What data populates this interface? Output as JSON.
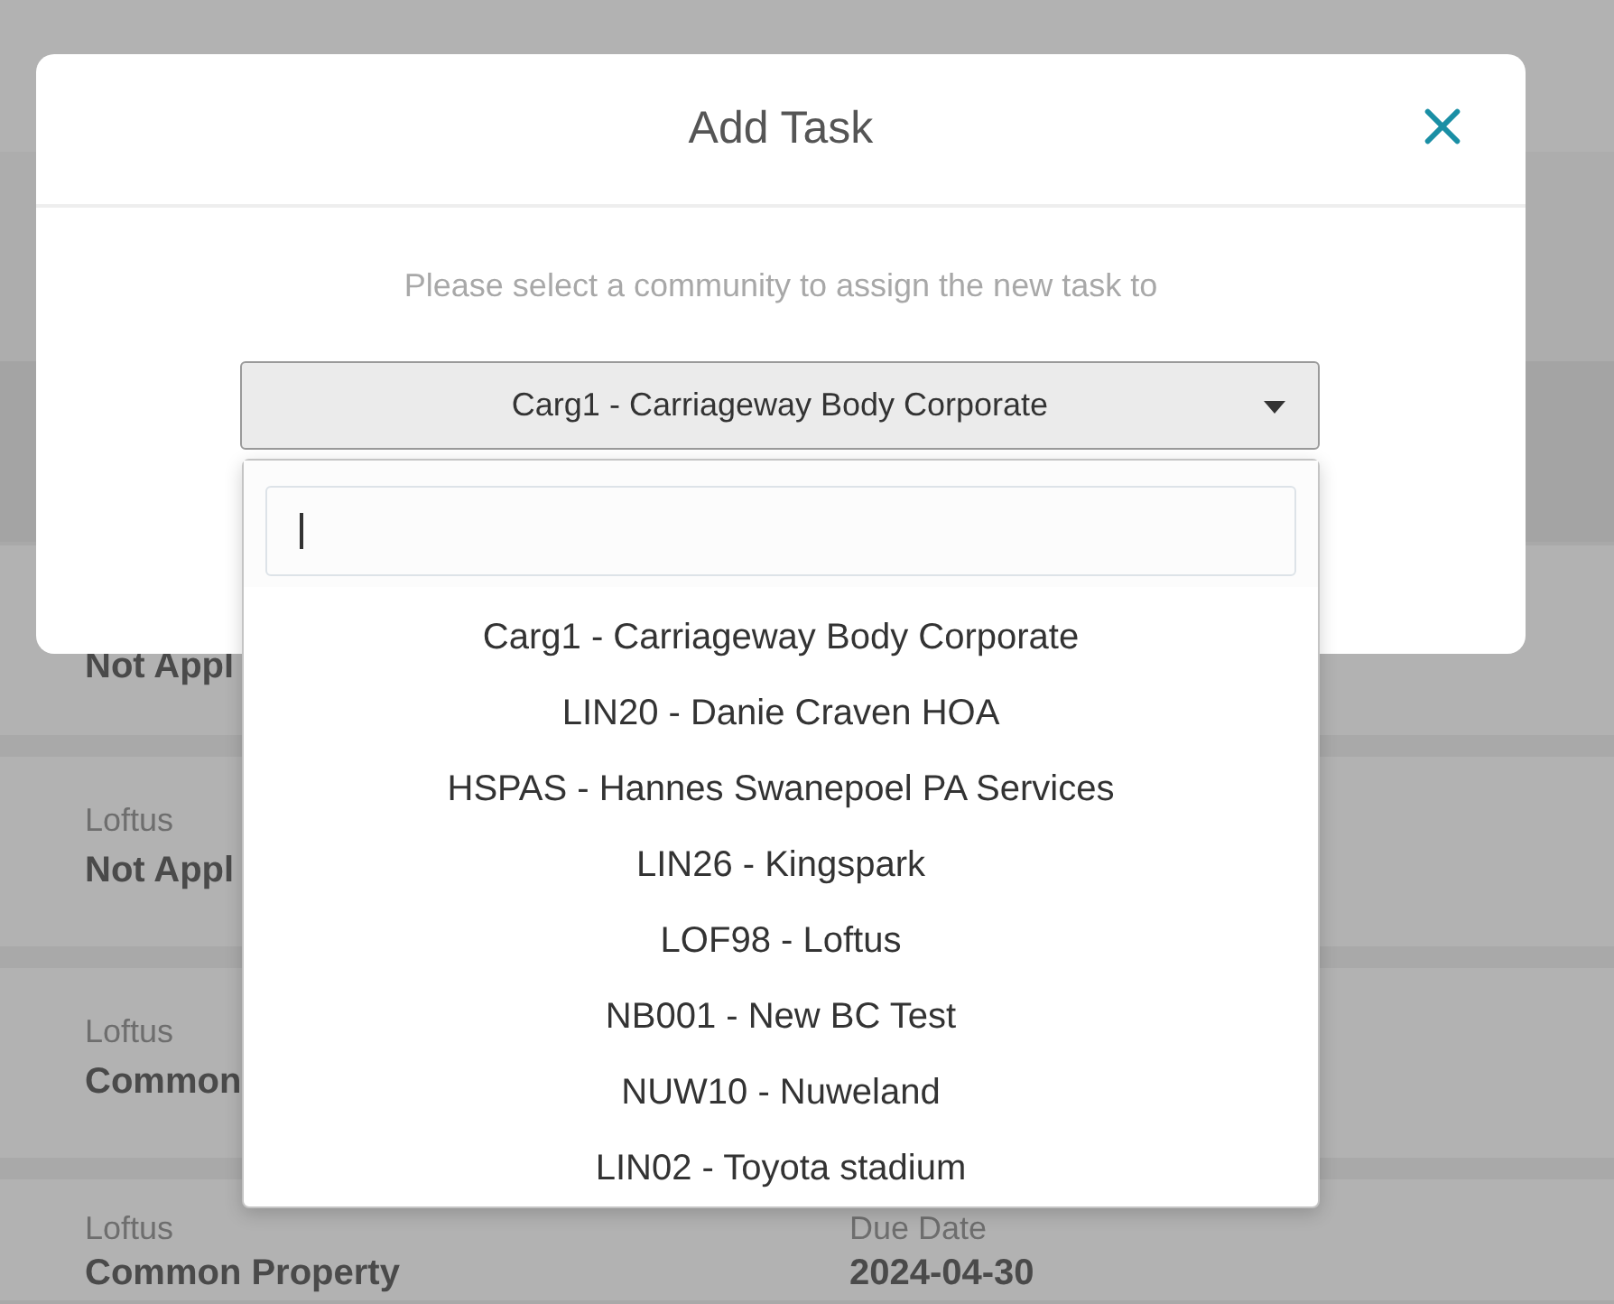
{
  "background": {
    "cards": [
      {
        "value": "Not Appl"
      },
      {
        "label": "Loftus",
        "value": "Not Appl"
      },
      {
        "label": "Loftus",
        "value": "Common"
      },
      {
        "label": "Loftus",
        "value": "Common Property",
        "fields": [
          {
            "label": "Due Date",
            "value": "2024-04-30"
          }
        ]
      }
    ]
  },
  "modal": {
    "title": "Add Task",
    "prompt": "Please select a community to assign the new task to",
    "select": {
      "value": "Carg1 - Carriageway Body Corporate"
    },
    "dropdown": {
      "options": [
        {
          "label": "Carg1 - Carriageway Body Corporate"
        },
        {
          "label": "LIN20 - Danie Craven HOA"
        },
        {
          "label": "HSPAS - Hannes Swanepoel PA Services"
        },
        {
          "label": "LIN26 - Kingspark"
        },
        {
          "label": "LOF98 - Loftus"
        },
        {
          "label": "NB001 - New BC Test"
        },
        {
          "label": "NUW10 - Nuweland"
        },
        {
          "label": "LIN02 - Toyota stadium"
        }
      ]
    }
  }
}
